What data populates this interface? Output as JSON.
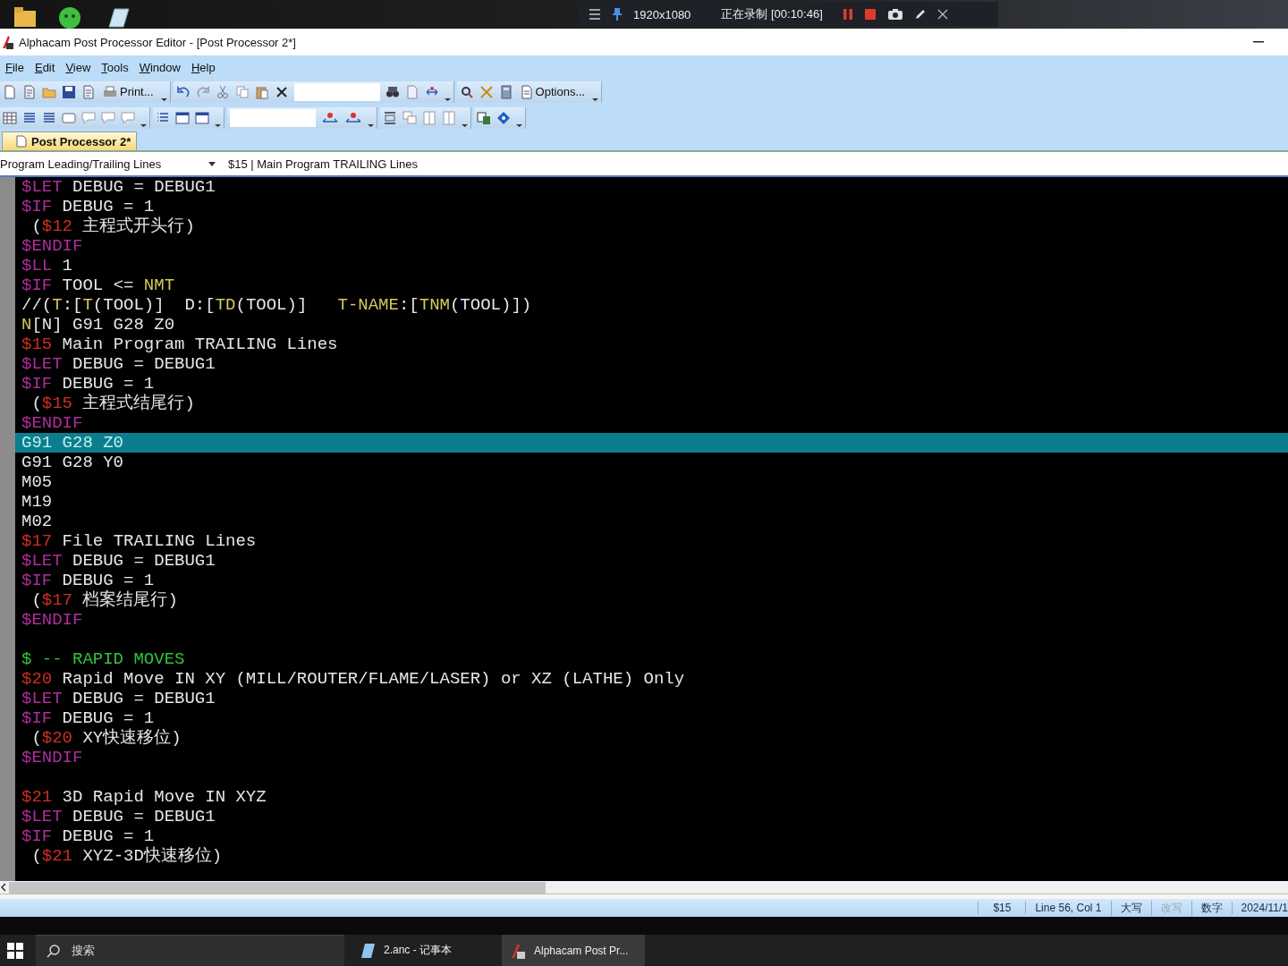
{
  "recorder": {
    "resolution": "1920x1080",
    "status": "正在录制 [00:10:46]"
  },
  "window": {
    "title": "Alphacam Post Processor Editor - [Post Processor 2*]"
  },
  "menu": [
    "File",
    "Edit",
    "View",
    "Tools",
    "Window",
    "Help"
  ],
  "toolbar": {
    "print_button": "Print...",
    "options_button": "Options..."
  },
  "tabs": [
    {
      "label": "Post Processor 2*",
      "selected": true
    }
  ],
  "section_selector": {
    "value": "Program Leading/Trailing Lines"
  },
  "section_heading": "$15 | Main Program TRAILING Lines",
  "editor": {
    "lines": [
      {
        "kind": "code",
        "selected": false,
        "segments": [
          {
            "kind": "keyword",
            "text": "$LET"
          },
          {
            "kind": "plain",
            "text": " DEBUG = DEBUG1"
          }
        ]
      },
      {
        "kind": "code",
        "selected": false,
        "segments": [
          {
            "kind": "keyword",
            "text": "$IF"
          },
          {
            "kind": "plain",
            "text": " DEBUG = 1"
          }
        ]
      },
      {
        "kind": "code",
        "selected": false,
        "segments": [
          {
            "kind": "plain",
            "text": " ("
          },
          {
            "kind": "variable",
            "text": "$12"
          },
          {
            "kind": "plain",
            "text": " 主程式开头行)"
          }
        ]
      },
      {
        "kind": "code",
        "selected": false,
        "segments": [
          {
            "kind": "keyword",
            "text": "$ENDIF"
          }
        ]
      },
      {
        "kind": "code",
        "selected": false,
        "segments": [
          {
            "kind": "keyword",
            "text": "$LL"
          },
          {
            "kind": "plain",
            "text": " 1"
          }
        ]
      },
      {
        "kind": "code",
        "selected": false,
        "segments": [
          {
            "kind": "keyword",
            "text": "$IF"
          },
          {
            "kind": "plain",
            "text": " TOOL <= "
          },
          {
            "kind": "function",
            "text": "NMT"
          }
        ]
      },
      {
        "kind": "code",
        "selected": false,
        "segments": [
          {
            "kind": "plain",
            "text": "//("
          },
          {
            "kind": "function",
            "text": "T"
          },
          {
            "kind": "plain",
            "text": ":["
          },
          {
            "kind": "function",
            "text": "T"
          },
          {
            "kind": "plain",
            "text": "(TOOL)]  D:["
          },
          {
            "kind": "function",
            "text": "TD"
          },
          {
            "kind": "plain",
            "text": "(TOOL)]   "
          },
          {
            "kind": "function",
            "text": "T-NAME"
          },
          {
            "kind": "plain",
            "text": ":["
          },
          {
            "kind": "function",
            "text": "TNM"
          },
          {
            "kind": "plain",
            "text": "(TOOL)])"
          }
        ]
      },
      {
        "kind": "code",
        "selected": false,
        "segments": [
          {
            "kind": "function",
            "text": "N"
          },
          {
            "kind": "plain",
            "text": "[N] G91 G28 Z0"
          }
        ]
      },
      {
        "kind": "code",
        "selected": false,
        "segments": [
          {
            "kind": "variable",
            "text": "$15"
          },
          {
            "kind": "plain",
            "text": " Main Program TRAILING Lines"
          }
        ]
      },
      {
        "kind": "code",
        "selected": false,
        "segments": [
          {
            "kind": "keyword",
            "text": "$LET"
          },
          {
            "kind": "plain",
            "text": " DEBUG = DEBUG1"
          }
        ]
      },
      {
        "kind": "code",
        "selected": false,
        "segments": [
          {
            "kind": "keyword",
            "text": "$IF"
          },
          {
            "kind": "plain",
            "text": " DEBUG = 1"
          }
        ]
      },
      {
        "kind": "code",
        "selected": false,
        "segments": [
          {
            "kind": "plain",
            "text": " ("
          },
          {
            "kind": "variable",
            "text": "$15"
          },
          {
            "kind": "plain",
            "text": " 主程式结尾行)"
          }
        ]
      },
      {
        "kind": "code",
        "selected": false,
        "segments": [
          {
            "kind": "keyword",
            "text": "$ENDIF"
          }
        ]
      },
      {
        "kind": "code",
        "selected": true,
        "segments": [
          {
            "kind": "plain",
            "text": "G91 G28 Z0"
          }
        ]
      },
      {
        "kind": "code",
        "selected": false,
        "segments": [
          {
            "kind": "plain",
            "text": "G91 G28 Y0"
          }
        ]
      },
      {
        "kind": "code",
        "selected": false,
        "segments": [
          {
            "kind": "plain",
            "text": "M05"
          }
        ]
      },
      {
        "kind": "code",
        "selected": false,
        "segments": [
          {
            "kind": "plain",
            "text": "M19"
          }
        ]
      },
      {
        "kind": "code",
        "selected": false,
        "segments": [
          {
            "kind": "plain",
            "text": "M02"
          }
        ]
      },
      {
        "kind": "code",
        "selected": false,
        "segments": [
          {
            "kind": "variable",
            "text": "$17"
          },
          {
            "kind": "plain",
            "text": " File TRAILING Lines"
          }
        ]
      },
      {
        "kind": "code",
        "selected": false,
        "segments": [
          {
            "kind": "keyword",
            "text": "$LET"
          },
          {
            "kind": "plain",
            "text": " DEBUG = DEBUG1"
          }
        ]
      },
      {
        "kind": "code",
        "selected": false,
        "segments": [
          {
            "kind": "keyword",
            "text": "$IF"
          },
          {
            "kind": "plain",
            "text": " DEBUG = 1"
          }
        ]
      },
      {
        "kind": "code",
        "selected": false,
        "segments": [
          {
            "kind": "plain",
            "text": " ("
          },
          {
            "kind": "variable",
            "text": "$17"
          },
          {
            "kind": "plain",
            "text": " 档案结尾行)"
          }
        ]
      },
      {
        "kind": "code",
        "selected": false,
        "segments": [
          {
            "kind": "keyword",
            "text": "$ENDIF"
          }
        ]
      },
      {
        "kind": "blank",
        "selected": false
      },
      {
        "kind": "code",
        "selected": false,
        "segments": [
          {
            "kind": "comment",
            "text": "$ -- RAPID MOVES"
          }
        ]
      },
      {
        "kind": "code",
        "selected": false,
        "segments": [
          {
            "kind": "variable",
            "text": "$20"
          },
          {
            "kind": "plain",
            "text": " Rapid Move IN XY (MILL/ROUTER/FLAME/LASER) or XZ (LATHE) Only"
          }
        ]
      },
      {
        "kind": "code",
        "selected": false,
        "segments": [
          {
            "kind": "keyword",
            "text": "$LET"
          },
          {
            "kind": "plain",
            "text": " DEBUG = DEBUG1"
          }
        ]
      },
      {
        "kind": "code",
        "selected": false,
        "segments": [
          {
            "kind": "keyword",
            "text": "$IF"
          },
          {
            "kind": "plain",
            "text": " DEBUG = 1"
          }
        ]
      },
      {
        "kind": "code",
        "selected": false,
        "segments": [
          {
            "kind": "plain",
            "text": " ("
          },
          {
            "kind": "variable",
            "text": "$20"
          },
          {
            "kind": "plain",
            "text": " XY快速移位)"
          }
        ]
      },
      {
        "kind": "code",
        "selected": false,
        "segments": [
          {
            "kind": "keyword",
            "text": "$ENDIF"
          }
        ]
      },
      {
        "kind": "blank",
        "selected": false
      },
      {
        "kind": "code",
        "selected": false,
        "segments": [
          {
            "kind": "variable",
            "text": "$21"
          },
          {
            "kind": "plain",
            "text": " 3D Rapid Move IN XYZ"
          }
        ]
      },
      {
        "kind": "code",
        "selected": false,
        "segments": [
          {
            "kind": "keyword",
            "text": "$LET"
          },
          {
            "kind": "plain",
            "text": " DEBUG = DEBUG1"
          }
        ]
      },
      {
        "kind": "code",
        "selected": false,
        "segments": [
          {
            "kind": "keyword",
            "text": "$IF"
          },
          {
            "kind": "plain",
            "text": " DEBUG = 1"
          }
        ]
      },
      {
        "kind": "code",
        "selected": false,
        "segments": [
          {
            "kind": "plain",
            "text": " ("
          },
          {
            "kind": "variable",
            "text": "$21"
          },
          {
            "kind": "plain",
            "text": " XYZ-3D快速移位)"
          }
        ]
      }
    ]
  },
  "status_bar": {
    "items": [
      {
        "text": "$15",
        "disabled": false
      },
      {
        "text": "Line 56, Col 1",
        "disabled": false
      },
      {
        "text": "大写",
        "disabled": false
      },
      {
        "text": "改写",
        "disabled": true
      },
      {
        "text": "数字",
        "disabled": false
      },
      {
        "text": "2024/11/1",
        "disabled": false
      }
    ]
  },
  "taskbar": {
    "search_placeholder": "搜索",
    "items": [
      {
        "kind": "notepad",
        "label": "2.anc - 记事本",
        "selected": false
      },
      {
        "kind": "alphacam",
        "label": "Alphacam Post Pr...",
        "selected": true
      }
    ]
  }
}
